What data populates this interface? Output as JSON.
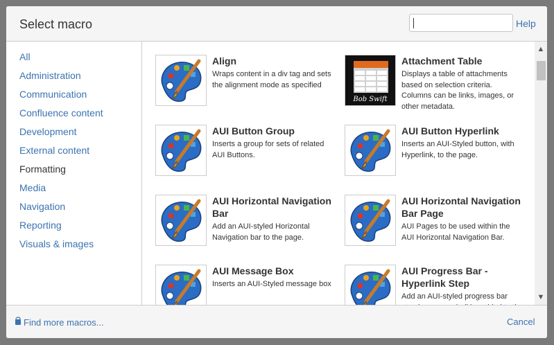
{
  "dialog": {
    "title": "Select macro",
    "help_label": "Help",
    "search": {
      "value": "",
      "placeholder": ""
    }
  },
  "sidebar": {
    "categories": [
      {
        "label": "All",
        "active": false
      },
      {
        "label": "Administration",
        "active": false
      },
      {
        "label": "Communication",
        "active": false
      },
      {
        "label": "Confluence content",
        "active": false
      },
      {
        "label": "Development",
        "active": false
      },
      {
        "label": "External content",
        "active": false
      },
      {
        "label": "Formatting",
        "active": true
      },
      {
        "label": "Media",
        "active": false
      },
      {
        "label": "Navigation",
        "active": false
      },
      {
        "label": "Reporting",
        "active": false
      },
      {
        "label": "Visuals & images",
        "active": false
      }
    ]
  },
  "macros": [
    {
      "name": "Align",
      "description": "Wraps content in a div tag and sets the alignment mode as specified",
      "icon": "palette-icon"
    },
    {
      "name": "Attachment Table",
      "description": "Displays a table of attachments based on selection criteria. Columns can be links, images, or other metadata.",
      "icon": "bob-swift-table-icon",
      "brand_text": "Bob Swift"
    },
    {
      "name": "AUI Button Group",
      "description": "Inserts a group for sets of related AUI Buttons.",
      "icon": "palette-icon"
    },
    {
      "name": "AUI Button Hyperlink",
      "description": "Inserts an AUI-Styled button, with Hyperlink, to the page.",
      "icon": "palette-icon"
    },
    {
      "name": "AUI Horizontal Navigation Bar",
      "description": "Add an AUI-styled Horizontal Navigation bar to the page.",
      "icon": "palette-icon"
    },
    {
      "name": "AUI Horizontal Navigation Bar Page",
      "description": "AUI Pages to be used within the AUI Horizontal Navigation Bar.",
      "icon": "palette-icon"
    },
    {
      "name": "AUI Message Box",
      "description": "Inserts an AUI-Styled message box",
      "icon": "palette-icon"
    },
    {
      "name": "AUI Progress Bar - Hyperlink Step",
      "description": "Add an AUI-styled progress bar step hyperrr.... shall be added to the",
      "icon": "palette-icon"
    }
  ],
  "footer": {
    "find_more_label": "Find more macros...",
    "cancel_label": "Cancel"
  },
  "colors": {
    "link": "#3b73af",
    "text": "#333333",
    "overlay": "#7a7a7a"
  }
}
